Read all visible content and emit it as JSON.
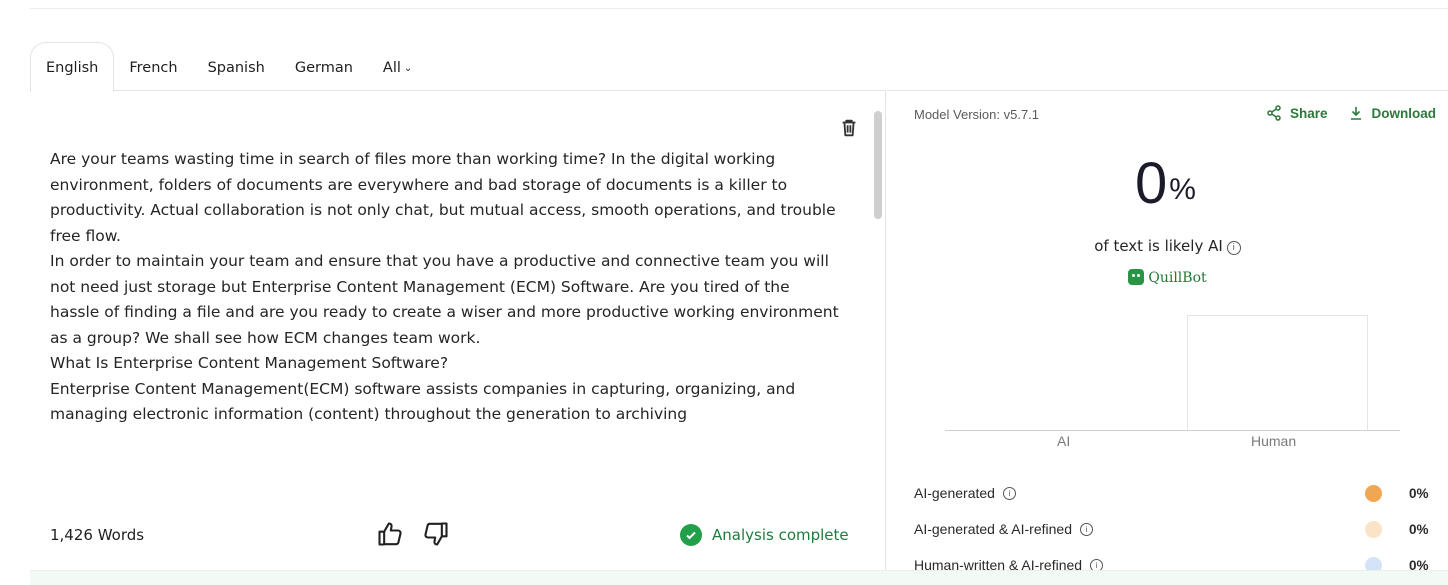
{
  "tabs": [
    {
      "label": "English"
    },
    {
      "label": "French"
    },
    {
      "label": "Spanish"
    },
    {
      "label": "German"
    },
    {
      "label": "All"
    }
  ],
  "editor": {
    "paragraphs": [
      "Are your teams wasting time in search of files more than working time? In the digital working environment, folders of documents are everywhere and bad storage of documents is a killer to productivity. Actual collaboration is not only chat, but mutual access, smooth operations, and trouble free flow.",
      "In order to maintain your team and ensure that you have a productive and connective team you will not need just storage but Enterprise Content Management (ECM) Software. Are you tired of the hassle of finding a file and are you ready to create a wiser and more productive working environment as a group? We shall see how ECM changes team work.",
      "What Is Enterprise Content Management Software?",
      "Enterprise Content Management(ECM) software assists companies in capturing, organizing, and managing electronic information (content) throughout the generation to archiving"
    ],
    "word_count": "1,426 Words",
    "status": "Analysis complete"
  },
  "results": {
    "model_version": "Model Version: v5.7.1",
    "share_label": "Share",
    "download_label": "Download",
    "percent_value": "0",
    "percent_sign": "%",
    "likely_text": "of text is likely AI",
    "brand": "QuillBot",
    "legend": [
      {
        "label": "AI-generated",
        "percent": "0%",
        "color": "#f0a652"
      },
      {
        "label": "AI-generated & AI-refined",
        "percent": "0%",
        "color": "#fbe3c7"
      },
      {
        "label": "Human-written & AI-refined",
        "percent": "0%",
        "color": "#d5e3f8"
      }
    ]
  },
  "chart_data": {
    "type": "bar",
    "categories": [
      "AI",
      "Human"
    ],
    "values": [
      0,
      100
    ],
    "ylim": [
      0,
      100
    ]
  },
  "colors": {
    "accent_green": "#2b7a3a",
    "check_green": "#22a049"
  }
}
